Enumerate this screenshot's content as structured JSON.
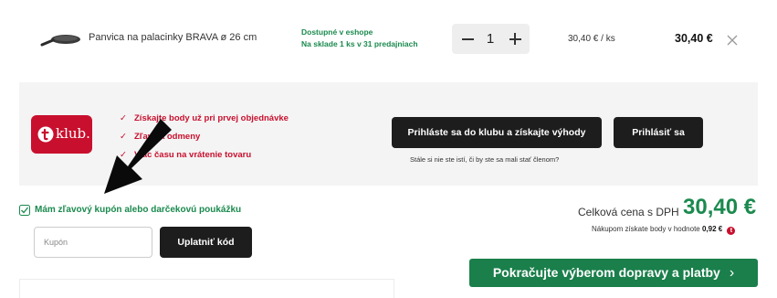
{
  "product": {
    "image_icon": "frying-pan-icon",
    "name": "Panvica na palacinky BRAVA ø 26 cm",
    "availability_line1": "Dostupné v eshope",
    "availability_line2": "Na sklade 1 ks v 31 predajniach",
    "quantity": "1",
    "unit_price": "30,40 € / ks",
    "total_price": "30,40 €",
    "remove_icon": "close-icon"
  },
  "club": {
    "logo_text": "klub.",
    "benefits": [
      "Získajte body už pri prvej objednávke",
      "Zľavy a odmeny",
      "Viac času na vrátenie tovaru"
    ],
    "join_button": "Prihláste sa do klubu a získajte výhody",
    "login_button": "Prihlásiť sa",
    "note": "Stále si nie ste istí, či by ste sa mali stať členom?"
  },
  "coupon": {
    "checkbox_label": "Mám zľavový kupón alebo darčekovú poukážku",
    "checked": true,
    "input_placeholder": "Kupón",
    "input_value": "",
    "apply_button": "Uplatniť kód"
  },
  "summary": {
    "total_label": "Celková cena s DPH",
    "total_value": "30,40 €",
    "points_text": "Nákupom získate body v hodnote",
    "points_value": "0,92 €",
    "continue_button": "Pokračujte výberom dopravy a platby"
  },
  "colors": {
    "brand_green": "#1a7f4b",
    "brand_red": "#c8102e",
    "dark_button": "#1d1d1d"
  }
}
